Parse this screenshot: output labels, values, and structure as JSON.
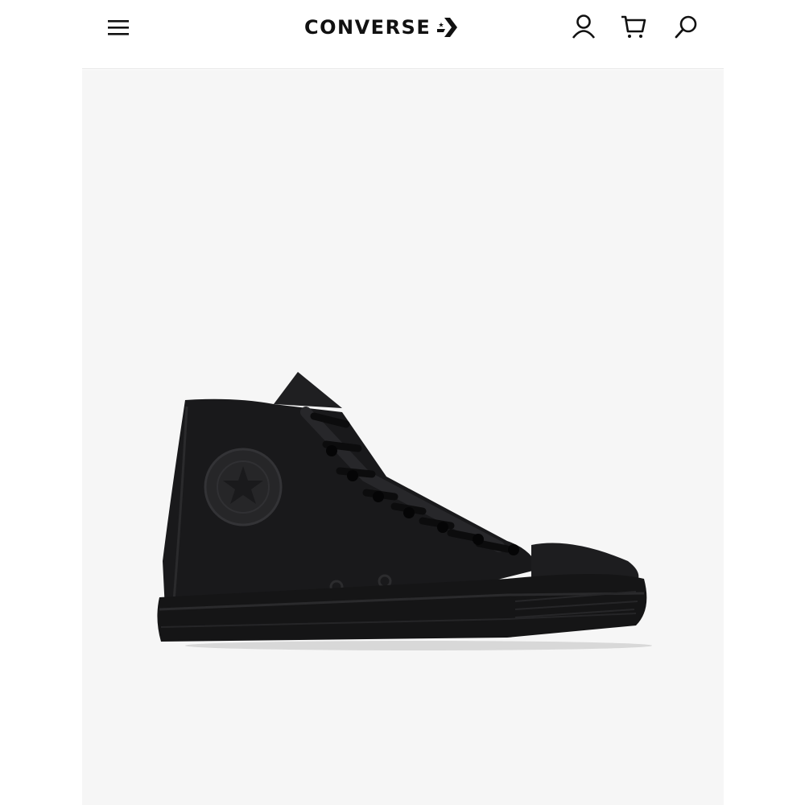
{
  "header": {
    "brand": "CONVERSE",
    "icons": {
      "menu": "hamburger-menu-icon",
      "logo_mark": "star-chevron-logo-icon",
      "account": "user-icon",
      "cart": "shopping-cart-icon",
      "search": "search-icon"
    }
  },
  "product": {
    "image": "black-monochrome-high-top-sneaker"
  },
  "colors": {
    "background": "#ffffff",
    "panel": "#f6f6f6",
    "text": "#111111",
    "divider": "#e4e4e4"
  }
}
